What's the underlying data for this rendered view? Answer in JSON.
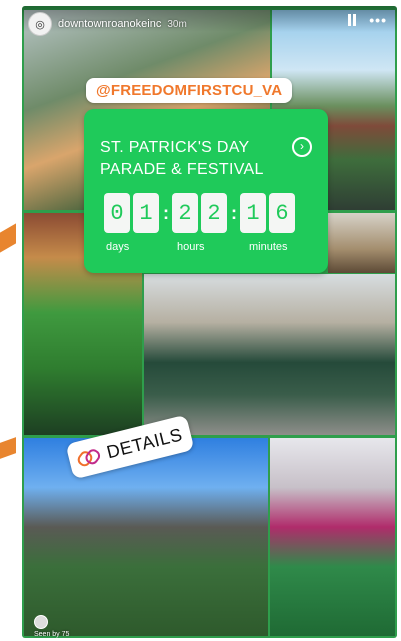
{
  "header": {
    "username": "downtownroanokeinc",
    "time": "30m"
  },
  "mention": "@FREEDOMFIRSTCU_VA",
  "countdown": {
    "title_line1": "ST. PATRICK'S DAY",
    "title_line2": "PARADE & FESTIVAL",
    "digits": [
      "0",
      "1",
      "2",
      "2",
      "1",
      "6"
    ],
    "colon": ":",
    "labels": {
      "days": "days",
      "hours": "hours",
      "minutes": "minutes"
    },
    "accent": "#1fca5a"
  },
  "details_sticker": "DETAILS",
  "seen": "Seen by 75",
  "colors": {
    "story_border": "#2f9e4c",
    "mention_text": "#f0782c",
    "side_arrow": "#e8852f"
  }
}
